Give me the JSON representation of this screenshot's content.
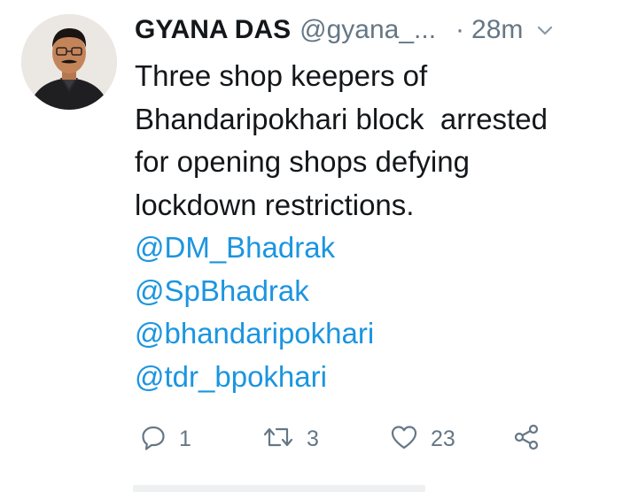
{
  "tweet": {
    "author_name": "GYANA DAS",
    "author_handle": "@gyana_...",
    "separator": "·",
    "time": "28m",
    "text_lines": [
      "Three shop keepers of",
      "Bhandaripokhari block  arrested",
      "for opening shops defying",
      "lockdown restrictions."
    ],
    "mentions": [
      "@DM_Bhadrak",
      "@SpBhadrak",
      "@bhandaripokhari",
      "@tdr_bpokhari"
    ],
    "actions": {
      "reply_count": "1",
      "retweet_count": "3",
      "like_count": "23"
    }
  },
  "colors": {
    "text": "#14171a",
    "secondary": "#657786",
    "link": "#1b95e0"
  },
  "icons": [
    "chevron-down-icon",
    "reply-icon",
    "retweet-icon",
    "like-icon",
    "share-icon"
  ]
}
